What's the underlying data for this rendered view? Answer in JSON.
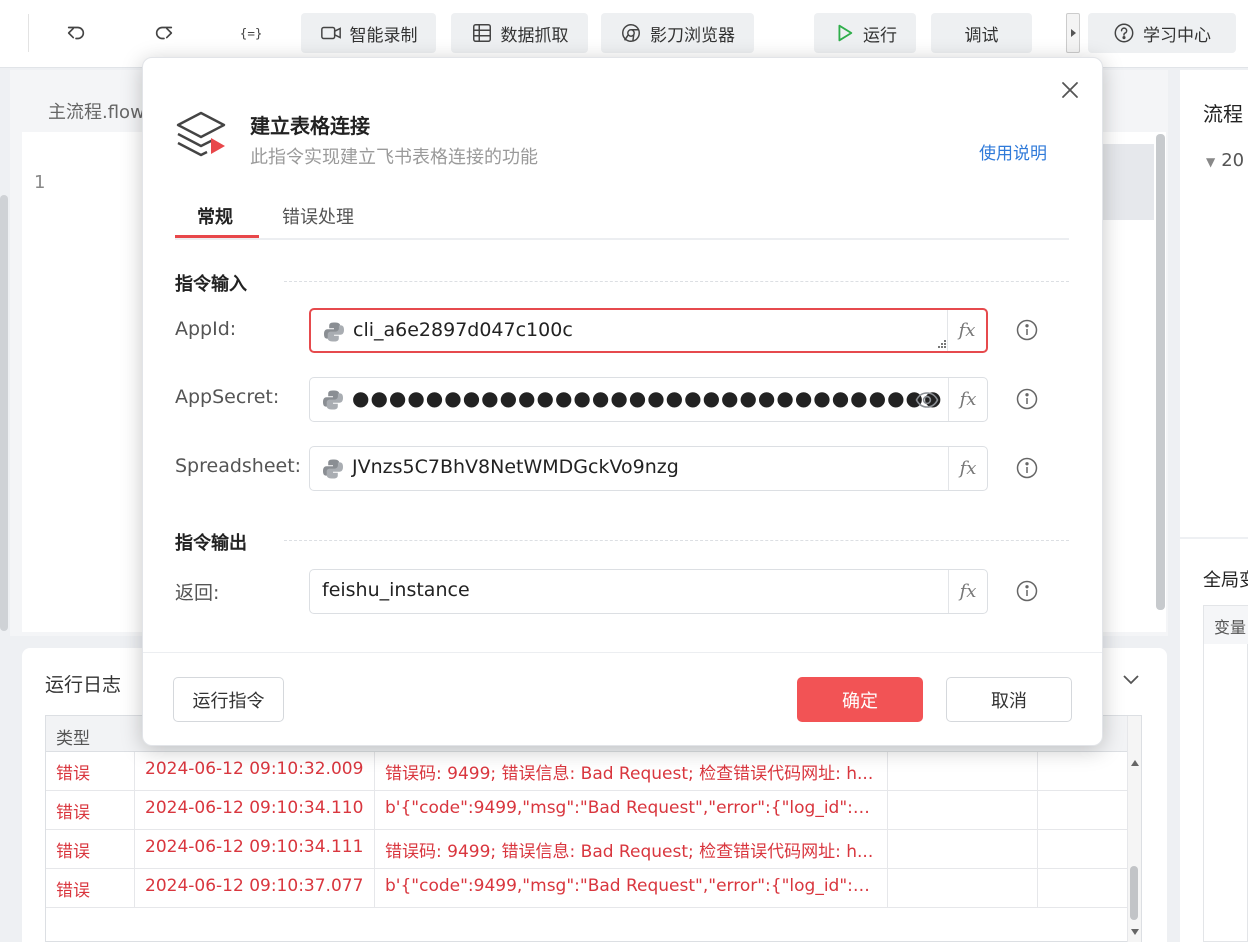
{
  "toolbar": {
    "undo_icon": "undo-icon",
    "redo_icon": "redo-icon",
    "variables_icon": "variables-icon",
    "buttons": [
      {
        "label": "智能录制",
        "icon": "video-record-icon"
      },
      {
        "label": "数据抓取",
        "icon": "table-grid-icon"
      },
      {
        "label": "影刀浏览器",
        "icon": "browser-icon"
      },
      {
        "label": "运行",
        "icon": "play-icon"
      },
      {
        "label": "调试",
        "icon": ""
      },
      {
        "label": "学习中心",
        "icon": "question-circle-icon"
      }
    ]
  },
  "editor": {
    "tab_label": "主流程.flow",
    "line_number": "1"
  },
  "right_panel": {
    "title": "流程",
    "tree_item": "20",
    "global_title": "全局变",
    "table_header": "变量"
  },
  "log": {
    "title": "运行日志",
    "type_header": "类型",
    "rows": [
      {
        "type": "错误",
        "time": "2024-06-12 09:10:32.009",
        "message": "错误码: 9499; 错误信息: Bad Request; 检查错误代码网址: h..."
      },
      {
        "type": "错误",
        "time": "2024-06-12 09:10:34.110",
        "message": "b'{\"code\":9499,\"msg\":\"Bad Request\",\"error\":{\"log_id\":\"2..."
      },
      {
        "type": "错误",
        "time": "2024-06-12 09:10:34.111",
        "message": "错误码: 9499; 错误信息: Bad Request; 检查错误代码网址: h..."
      },
      {
        "type": "错误",
        "time": "2024-06-12 09:10:37.077",
        "message": "b'{\"code\":9499,\"msg\":\"Bad Request\",\"error\":{\"log_id\":\"2..."
      }
    ]
  },
  "dialog": {
    "title": "建立表格连接",
    "subtitle": "此指令实现建立飞书表格连接的功能",
    "help_link": "使用说明",
    "tabs": [
      "常规",
      "错误处理"
    ],
    "active_tab": "常规",
    "input_section": "指令输入",
    "output_section": "指令输出",
    "fields": {
      "appid": {
        "label": "AppId:",
        "value": "cli_a6e2897d047c100c"
      },
      "appsecret": {
        "label": "AppSecret:",
        "value": "●●●●●●●●●●●●●●●●●●●●●●●●●●●●●●●●"
      },
      "spreadsheet": {
        "label": "Spreadsheet:",
        "value": "JVnzs5C7BhV8NetWMDGckVo9nzg"
      },
      "return": {
        "label": "返回:",
        "value": "feishu_instance"
      }
    },
    "fx_label": "fx",
    "run_button": "运行指令",
    "ok_button": "确定",
    "cancel_button": "取消"
  },
  "colors": {
    "accent": "#f25355",
    "error_text": "#d9363e",
    "link": "#2f7ad9",
    "play_green": "#2fae4b"
  }
}
